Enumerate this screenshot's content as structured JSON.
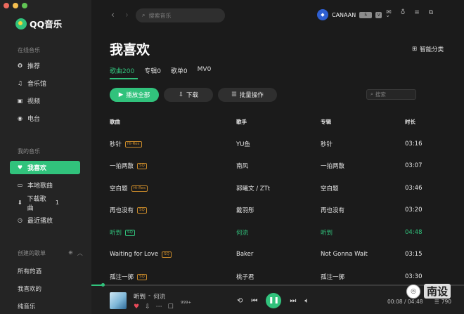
{
  "window": {
    "traffic_colors": [
      "#ed6a5e",
      "#f5bf4f",
      "#61c554"
    ]
  },
  "app": {
    "name": "QQ音乐"
  },
  "sidebar": {
    "online_title": "在线音乐",
    "online_items": [
      {
        "label": "推荐",
        "icon": "compass-icon"
      },
      {
        "label": "音乐馆",
        "icon": "music-note-icon"
      },
      {
        "label": "视频",
        "icon": "video-icon"
      },
      {
        "label": "电台",
        "icon": "radio-icon"
      }
    ],
    "mine_title": "我的音乐",
    "mine_items": [
      {
        "label": "我喜欢",
        "icon": "heart-icon",
        "active": true
      },
      {
        "label": "本地歌曲",
        "icon": "monitor-icon"
      },
      {
        "label": "下载歌曲",
        "icon": "download-icon",
        "count": "1"
      },
      {
        "label": "最近播放",
        "icon": "clock-icon"
      }
    ],
    "created_title": "创建的歌单",
    "created_items": [
      "所有的酒",
      "我喜欢的",
      "纯音乐"
    ]
  },
  "topbar": {
    "search_placeholder": "搜索音乐",
    "username": "CANAAN",
    "badge_a": "5",
    "badge_b": "V"
  },
  "page": {
    "title": "我喜欢",
    "smart_category": "智能分类",
    "tabs": [
      {
        "label": "歌曲200",
        "active": true
      },
      {
        "label": "专辑0"
      },
      {
        "label": "歌单0"
      },
      {
        "label": "MV0"
      }
    ],
    "play_all": "播放全部",
    "download": "下载",
    "batch": "批量操作",
    "list_search_placeholder": "搜索"
  },
  "table": {
    "headers": {
      "song": "歌曲",
      "artist": "歌手",
      "album": "专辑",
      "duration": "时长"
    },
    "rows": [
      {
        "song": "秒针",
        "tag": "Hi-Res",
        "artist": "YU鱼",
        "album": "秒针",
        "duration": "03:16"
      },
      {
        "song": "一拍两散",
        "tag": "SQ",
        "artist": "南风",
        "album": "一拍两散",
        "duration": "03:07"
      },
      {
        "song": "空白题",
        "tag": "Hi-Res",
        "artist": "郭曦文 / ZTt",
        "album": "空白题",
        "duration": "03:46"
      },
      {
        "song": "再也没有",
        "tag": "SQ",
        "artist": "戴羽彤",
        "album": "再也没有",
        "duration": "03:20"
      },
      {
        "song": "听到",
        "tag": "SQ",
        "artist": "何流",
        "album": "听到",
        "duration": "04:48",
        "playing": true
      },
      {
        "song": "Waiting for Love",
        "tag": "SQ",
        "artist": "Baker",
        "album": "Not Gonna Wait",
        "duration": "03:15"
      },
      {
        "song": "孤注一掷",
        "tag": "SQ",
        "artist": "桃子君",
        "album": "孤注一掷",
        "duration": "03:30"
      }
    ]
  },
  "player": {
    "title": "听到",
    "separator": "-",
    "artist": "何流",
    "comment_count": "999+",
    "time": "00:08 / 04:48",
    "listeners": "790",
    "progress": 0.03
  },
  "watermark": {
    "text": "南设"
  },
  "colors": {
    "accent": "#31c27c",
    "sidebar_bg": "#242424",
    "main_bg": "#1b1b1b"
  }
}
